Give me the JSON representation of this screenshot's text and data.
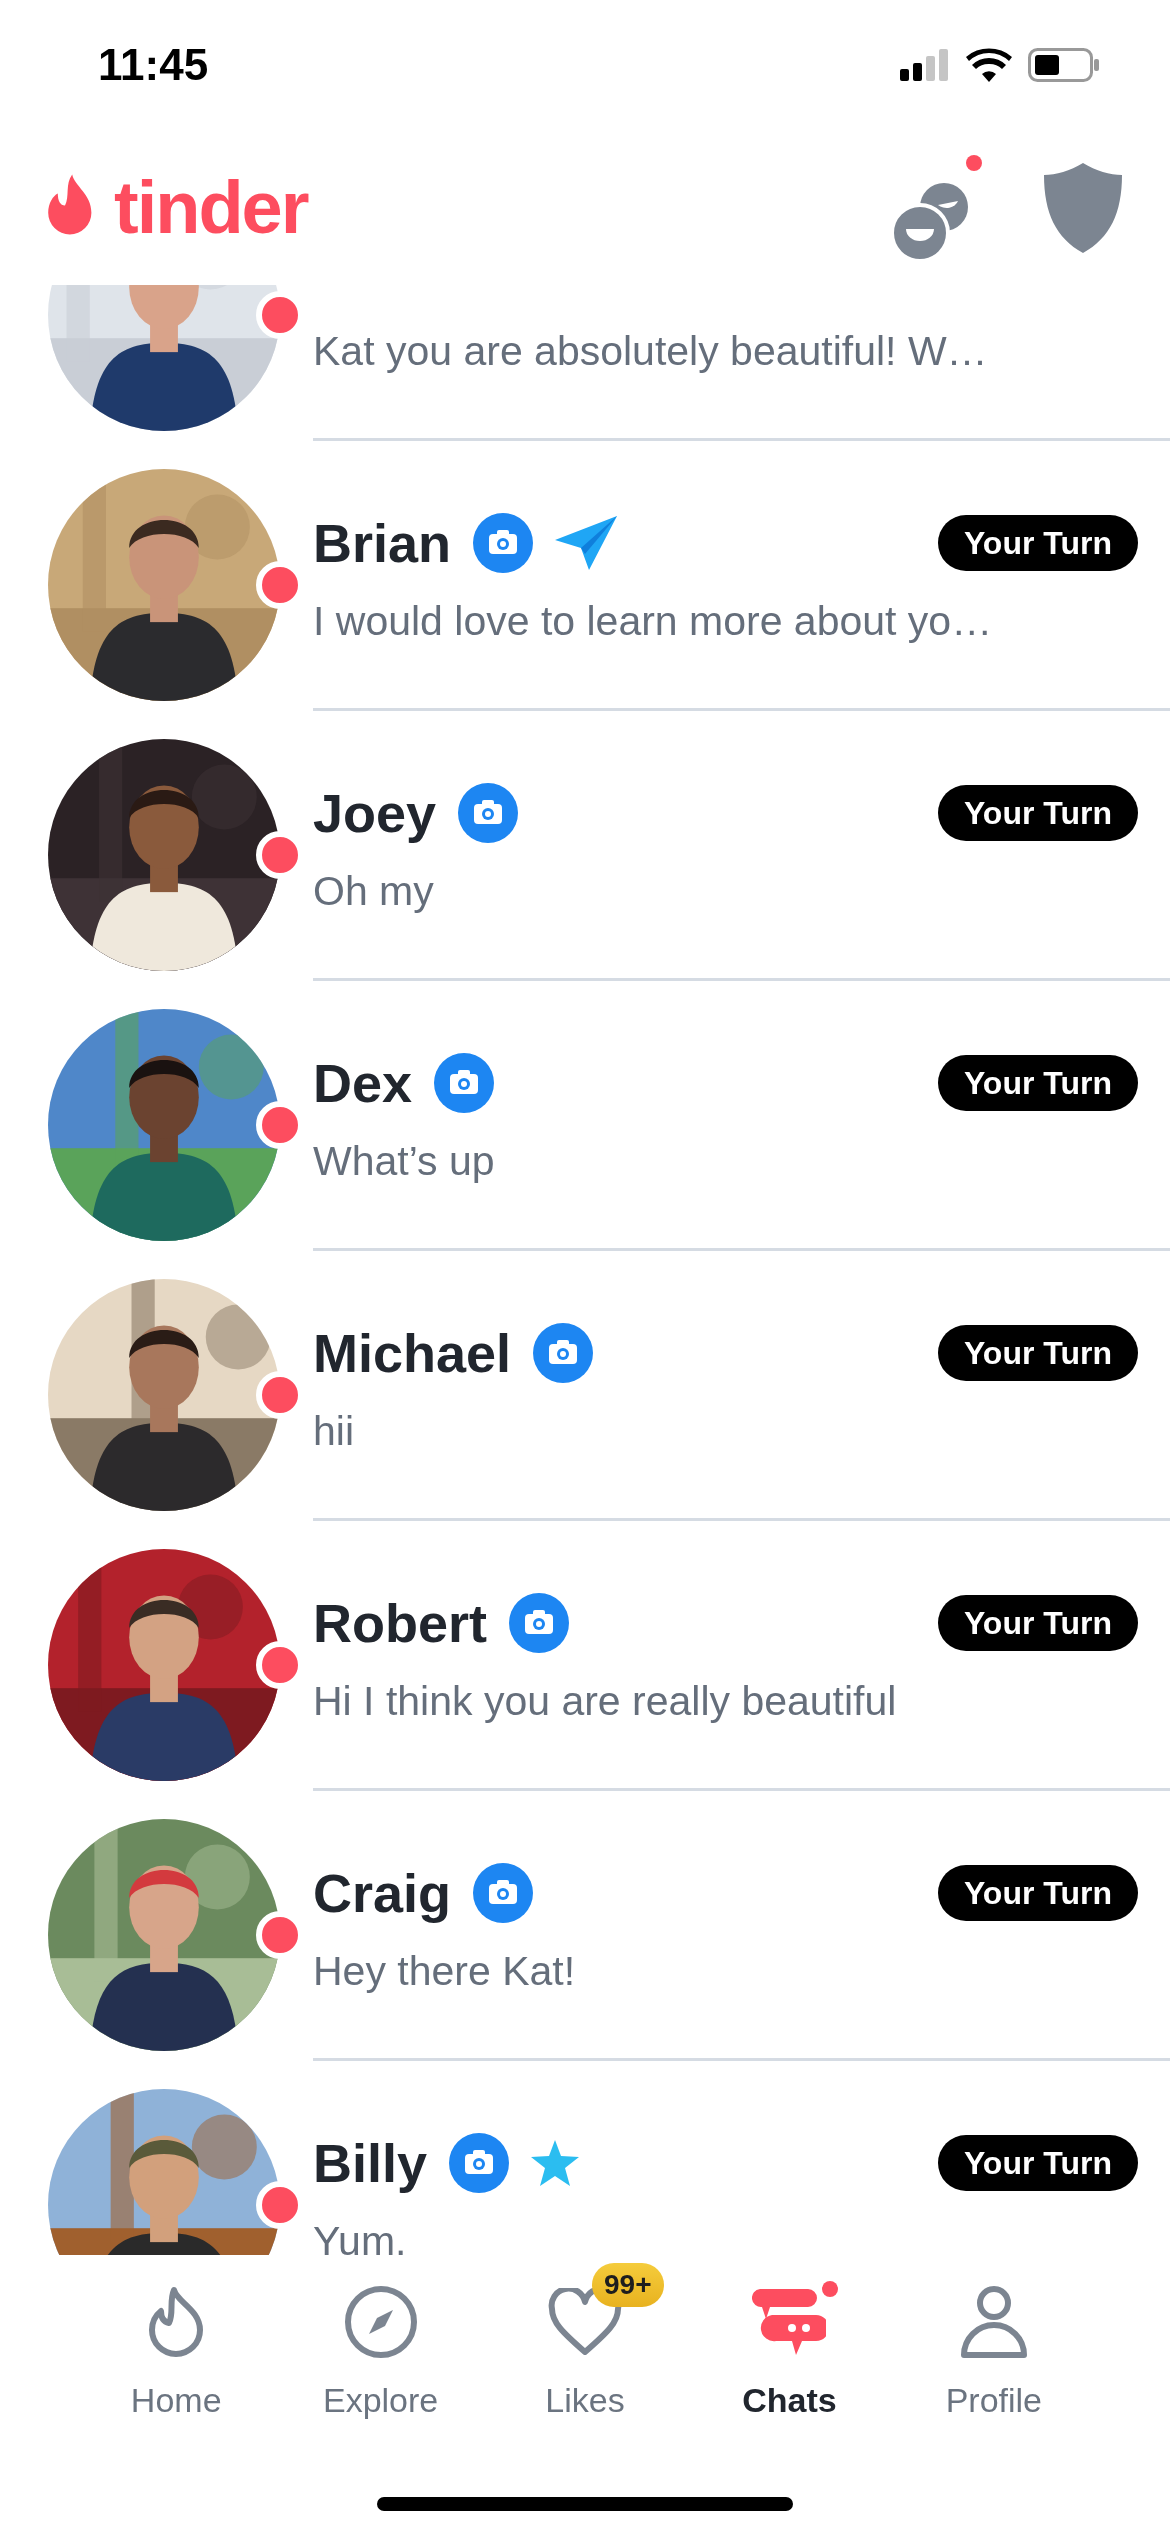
{
  "status_bar": {
    "time": "11:45"
  },
  "header": {
    "logo": "tinder",
    "matches_notification": true
  },
  "chats": [
    {
      "message": "Kat you are absolutely beautiful! W…",
      "unread": true,
      "avatar": {
        "kind": "picture"
      }
    },
    {
      "name": "Brian",
      "message": "I would love to learn more about yo…",
      "unread": true,
      "badges": [
        {
          "kind": "camera"
        },
        {
          "kind": "sent"
        }
      ],
      "turn": "Your Turn",
      "avatar": {
        "kind": "picture"
      }
    },
    {
      "name": "Joey",
      "message": "Oh my",
      "unread": true,
      "badges": [
        {
          "kind": "camera"
        }
      ],
      "turn": "Your Turn",
      "avatar": {
        "kind": "picture"
      }
    },
    {
      "name": "Dex",
      "message": "What’s up",
      "unread": true,
      "badges": [
        {
          "kind": "camera"
        }
      ],
      "turn": "Your Turn",
      "avatar": {
        "kind": "picture"
      }
    },
    {
      "name": "Michael",
      "message": "hii",
      "unread": true,
      "badges": [
        {
          "kind": "camera"
        }
      ],
      "turn": "Your Turn",
      "avatar": {
        "kind": "picture"
      }
    },
    {
      "name": "Robert",
      "message": "Hi I think you are really beautiful",
      "unread": true,
      "badges": [
        {
          "kind": "camera"
        }
      ],
      "turn": "Your Turn",
      "avatar": {
        "kind": "picture"
      }
    },
    {
      "name": "Craig",
      "message": "Hey there Kat!",
      "unread": true,
      "badges": [
        {
          "kind": "camera"
        }
      ],
      "turn": "Your Turn",
      "avatar": {
        "kind": "picture"
      }
    },
    {
      "name": "Billy",
      "message": "Yum.",
      "unread": true,
      "badges": [
        {
          "kind": "camera"
        },
        {
          "kind": "star"
        }
      ],
      "turn": "Your Turn",
      "avatar": {
        "kind": "picture"
      }
    }
  ],
  "tabs": [
    {
      "kind": "home",
      "label": "Home",
      "selected": false
    },
    {
      "kind": "explore",
      "label": "Explore",
      "selected": false
    },
    {
      "kind": "likes",
      "label": "Likes",
      "selected": false,
      "count": "99+"
    },
    {
      "kind": "chats",
      "label": "Chats",
      "selected": true,
      "notification": true
    },
    {
      "kind": "profile",
      "label": "Profile",
      "selected": false
    }
  ]
}
